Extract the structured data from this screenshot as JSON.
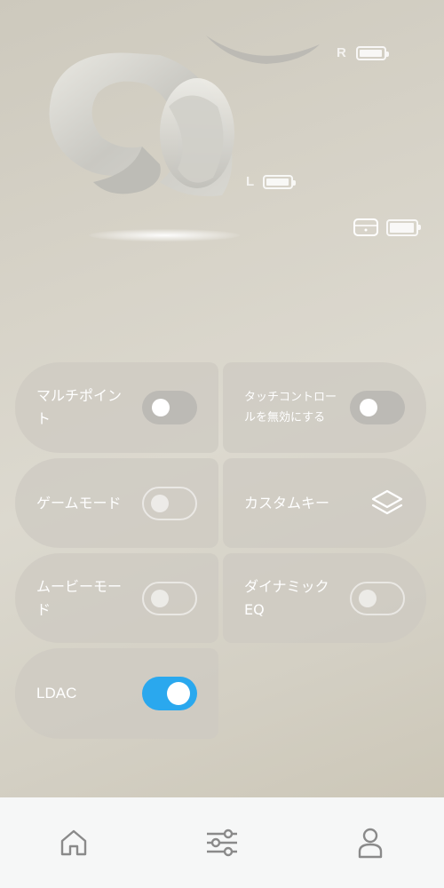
{
  "hero": {
    "right_label": "R",
    "left_label": "L",
    "right_battery_level": 0.95,
    "left_battery_level": 0.95,
    "case_battery_level": 0.95
  },
  "controls": [
    {
      "id": "multipoint",
      "label": "マルチポイント",
      "state": "off"
    },
    {
      "id": "touch-control-disable",
      "label": "タッチコントロールを無効にする",
      "state": "off"
    },
    {
      "id": "game-mode",
      "label": "ゲームモード",
      "state": "off-disabled"
    },
    {
      "id": "custom-key",
      "label": "カスタムキー",
      "icon": "layers-icon"
    },
    {
      "id": "movie-mode",
      "label": "ムービーモード",
      "state": "off-disabled"
    },
    {
      "id": "dynamic-eq",
      "label": "ダイナミックEQ",
      "state": "off-disabled"
    },
    {
      "id": "ldac",
      "label": "LDAC",
      "state": "on"
    }
  ],
  "nav": {
    "items": [
      {
        "icon": "home-icon"
      },
      {
        "icon": "sliders-icon"
      },
      {
        "icon": "person-icon"
      }
    ]
  },
  "colors": {
    "accent": "#2aa8ee",
    "nav_background": "#f6f7f7",
    "nav_icon": "#8a8a8a"
  }
}
